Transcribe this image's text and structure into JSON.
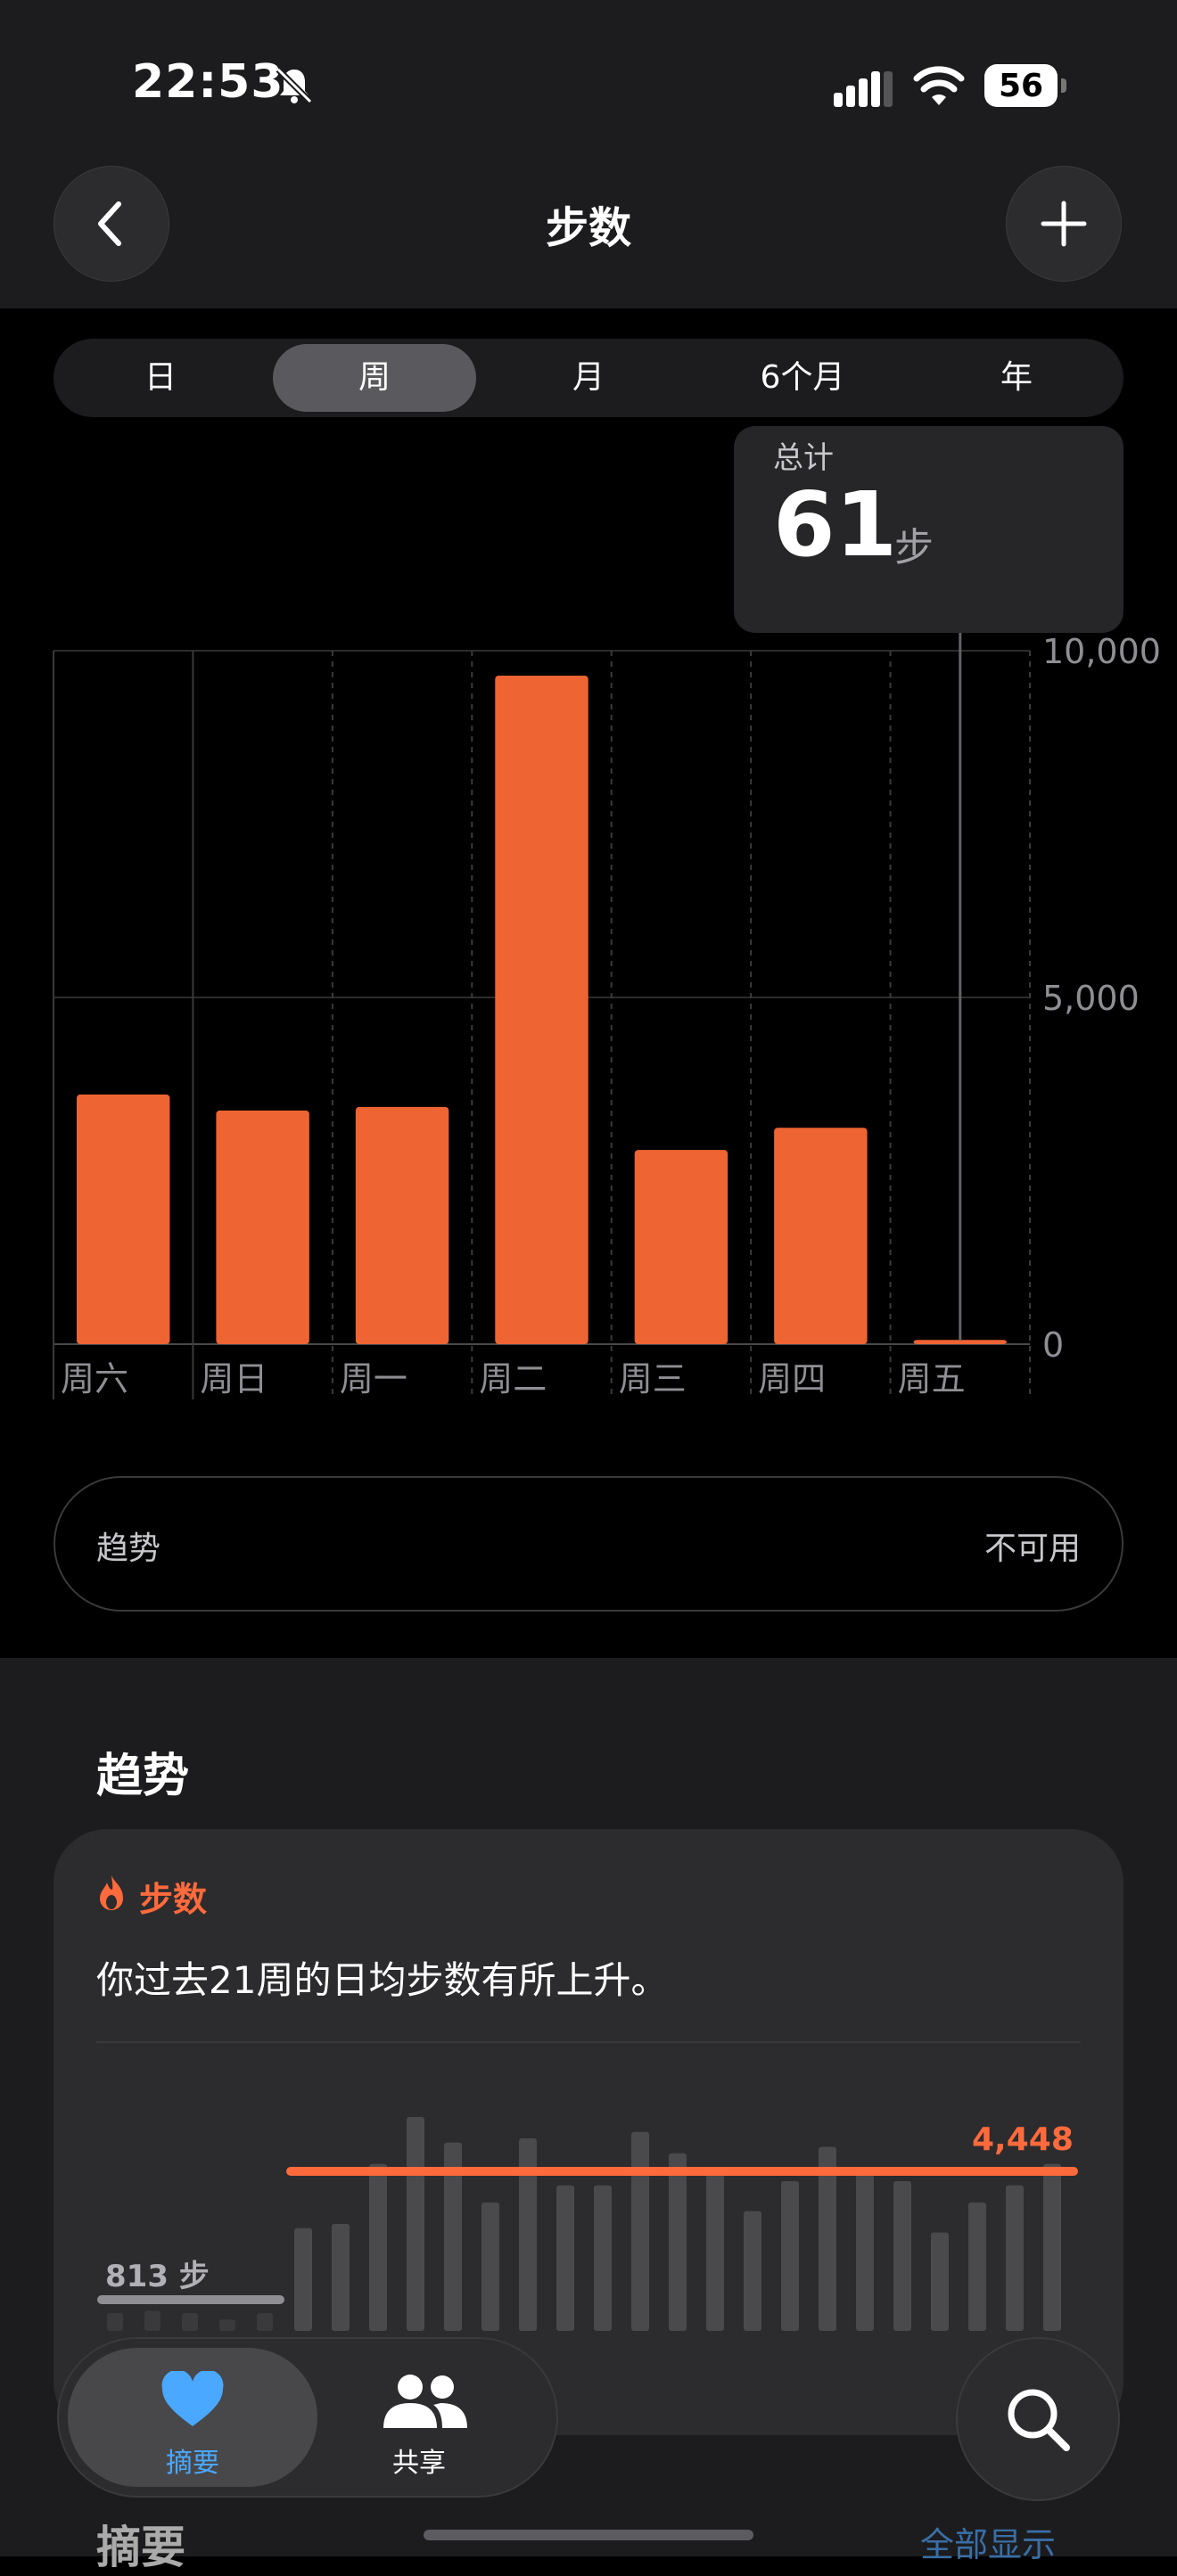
{
  "status": {
    "time": "22:53",
    "battery": "56"
  },
  "nav": {
    "title": "步数"
  },
  "segments": [
    "日",
    "周",
    "月",
    "6个月",
    "年"
  ],
  "selected_segment": "周",
  "tooltip": {
    "label": "总计",
    "value": "61",
    "unit": "步"
  },
  "chart_data": {
    "type": "bar",
    "categories": [
      "周六",
      "周日",
      "周一",
      "周二",
      "周三",
      "周四",
      "周五"
    ],
    "values": [
      3600,
      3370,
      3420,
      9640,
      2800,
      3120,
      61
    ],
    "ylim": [
      0,
      10000
    ],
    "y_ticks": [
      "10,000",
      "5,000",
      "0"
    ],
    "y_tick_values": [
      10000,
      5000,
      0
    ],
    "bar_color": "#ef6433",
    "grid": true,
    "selected_index": 6
  },
  "trend_pill": {
    "label": "趋势",
    "value": "不可用"
  },
  "trends_section": {
    "heading": "趋势",
    "card": {
      "title": "步数",
      "text": "你过去21周的日均步数有所上升。",
      "low_label": "813 步",
      "high_label": "4,448",
      "bar_heights": [
        0.3,
        0.55,
        0.45,
        0.4,
        0.48,
        0.5,
        0.78,
        1.0,
        0.88,
        0.6,
        0.9,
        0.68,
        0.68,
        0.93,
        0.83,
        0.73,
        0.56,
        0.7,
        0.86,
        0.73,
        0.7,
        0.46,
        0.6,
        0.68,
        0.78,
        0.73,
        0.83
      ],
      "accent": "#ff6a3c"
    },
    "summary_heading": "摘要",
    "show_all": "全部显示"
  },
  "tabbar": {
    "tab1": "摘要",
    "tab2": "共享"
  }
}
